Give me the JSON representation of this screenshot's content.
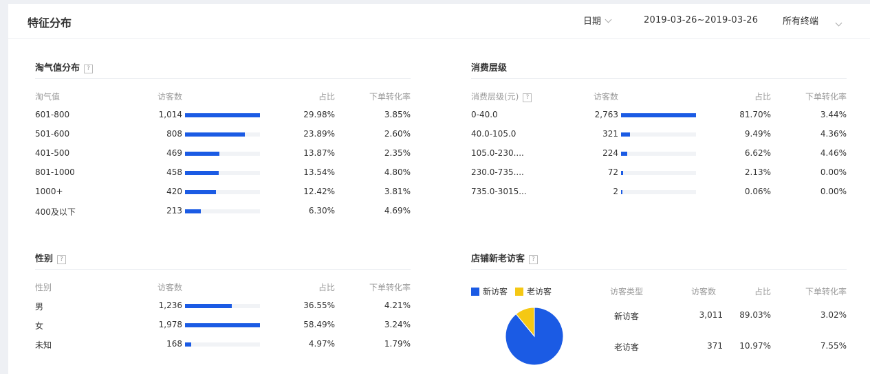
{
  "header": {
    "title": "特征分布",
    "date_label": "日期",
    "date_range": "2019-03-26~2019-03-26",
    "terminal_label": "所有终端"
  },
  "colors": {
    "bar": "#1b5be4",
    "new_visitor": "#1b5be4",
    "old_visitor": "#f5c814",
    "track": "#f1f3f6"
  },
  "taoqi": {
    "title": "淘气值分布",
    "help": "?",
    "columns": [
      "淘气值",
      "访客数",
      "占比",
      "下单转化率"
    ],
    "max": 1014,
    "rows": [
      {
        "label": "601-800",
        "visitors": "1,014",
        "value": 1014,
        "share": "29.98%",
        "conversion": "3.85%"
      },
      {
        "label": "501-600",
        "visitors": "808",
        "value": 808,
        "share": "23.89%",
        "conversion": "2.60%"
      },
      {
        "label": "401-500",
        "visitors": "469",
        "value": 469,
        "share": "13.87%",
        "conversion": "2.35%"
      },
      {
        "label": "801-1000",
        "visitors": "458",
        "value": 458,
        "share": "13.54%",
        "conversion": "4.80%"
      },
      {
        "label": "1000+",
        "visitors": "420",
        "value": 420,
        "share": "12.42%",
        "conversion": "3.81%"
      },
      {
        "label": "400及以下",
        "visitors": "213",
        "value": 213,
        "share": "6.30%",
        "conversion": "4.69%"
      }
    ]
  },
  "consumption": {
    "title": "消费层级",
    "columns": [
      "消费层级(元)",
      "访客数",
      "占比",
      "下单转化率"
    ],
    "help": "?",
    "max": 2763,
    "rows": [
      {
        "label": "0-40.0",
        "visitors": "2,763",
        "value": 2763,
        "share": "81.70%",
        "conversion": "3.44%"
      },
      {
        "label": "40.0-105.0",
        "visitors": "321",
        "value": 321,
        "share": "9.49%",
        "conversion": "4.36%"
      },
      {
        "label": "105.0-230....",
        "visitors": "224",
        "value": 224,
        "share": "6.62%",
        "conversion": "4.46%"
      },
      {
        "label": "230.0-735....",
        "visitors": "72",
        "value": 72,
        "share": "2.13%",
        "conversion": "0.00%"
      },
      {
        "label": "735.0-3015...",
        "visitors": "2",
        "value": 2,
        "share": "0.06%",
        "conversion": "0.00%"
      }
    ]
  },
  "gender": {
    "title": "性别",
    "help": "?",
    "columns": [
      "性别",
      "访客数",
      "占比",
      "下单转化率"
    ],
    "max": 1978,
    "rows": [
      {
        "label": "男",
        "visitors": "1,236",
        "value": 1236,
        "share": "36.55%",
        "conversion": "4.21%"
      },
      {
        "label": "女",
        "visitors": "1,978",
        "value": 1978,
        "share": "58.49%",
        "conversion": "3.24%"
      },
      {
        "label": "未知",
        "visitors": "168",
        "value": 168,
        "share": "4.97%",
        "conversion": "1.79%"
      }
    ]
  },
  "visitors": {
    "title": "店铺新老访客",
    "help": "?",
    "legend": [
      "新访客",
      "老访客"
    ],
    "columns": [
      "访客类型",
      "访客数",
      "占比",
      "下单转化率"
    ],
    "rows": [
      {
        "label": "新访客",
        "visitors": "3,011",
        "share": "89.03%",
        "conversion": "3.02%"
      },
      {
        "label": "老访客",
        "visitors": "371",
        "share": "10.97%",
        "conversion": "7.55%"
      }
    ]
  },
  "chart_data": {
    "type": "pie",
    "categories": [
      "新访客",
      "老访客"
    ],
    "values": [
      89.03,
      10.97
    ]
  }
}
